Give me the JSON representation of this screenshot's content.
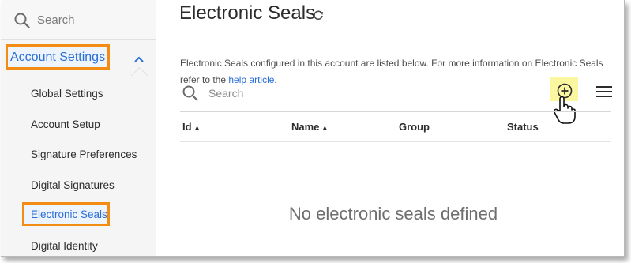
{
  "sidebar": {
    "search_placeholder": "Search",
    "section_label": "Account Settings",
    "items": [
      {
        "label": "Global Settings"
      },
      {
        "label": "Account Setup"
      },
      {
        "label": "Signature Preferences"
      },
      {
        "label": "Digital Signatures"
      },
      {
        "label": "Electronic Seals",
        "active": true
      },
      {
        "label": "Digital Identity"
      }
    ]
  },
  "main": {
    "title": "Electronic Seals",
    "description": "Electronic Seals configured in this account are listed below. For more information on Electronic Seals refer to the ",
    "link_text": "help article",
    "description_end": ".",
    "search_placeholder": "Search",
    "columns": [
      {
        "label": "Id",
        "sort": "asc"
      },
      {
        "label": "Name",
        "sort": "asc"
      },
      {
        "label": "Group"
      },
      {
        "label": "Status"
      }
    ],
    "empty_message": "No electronic seals defined"
  },
  "icons": {
    "search": "search-icon",
    "chevron": "chevron-up-icon",
    "refresh": "refresh-icon",
    "add": "add-circle-icon",
    "menu": "hamburger-menu-icon",
    "cursor": "hand-pointer-cursor"
  },
  "colors": {
    "highlight_border": "#f28c13",
    "link": "#2b6ed6",
    "add_highlight": "#fbf6a0"
  }
}
